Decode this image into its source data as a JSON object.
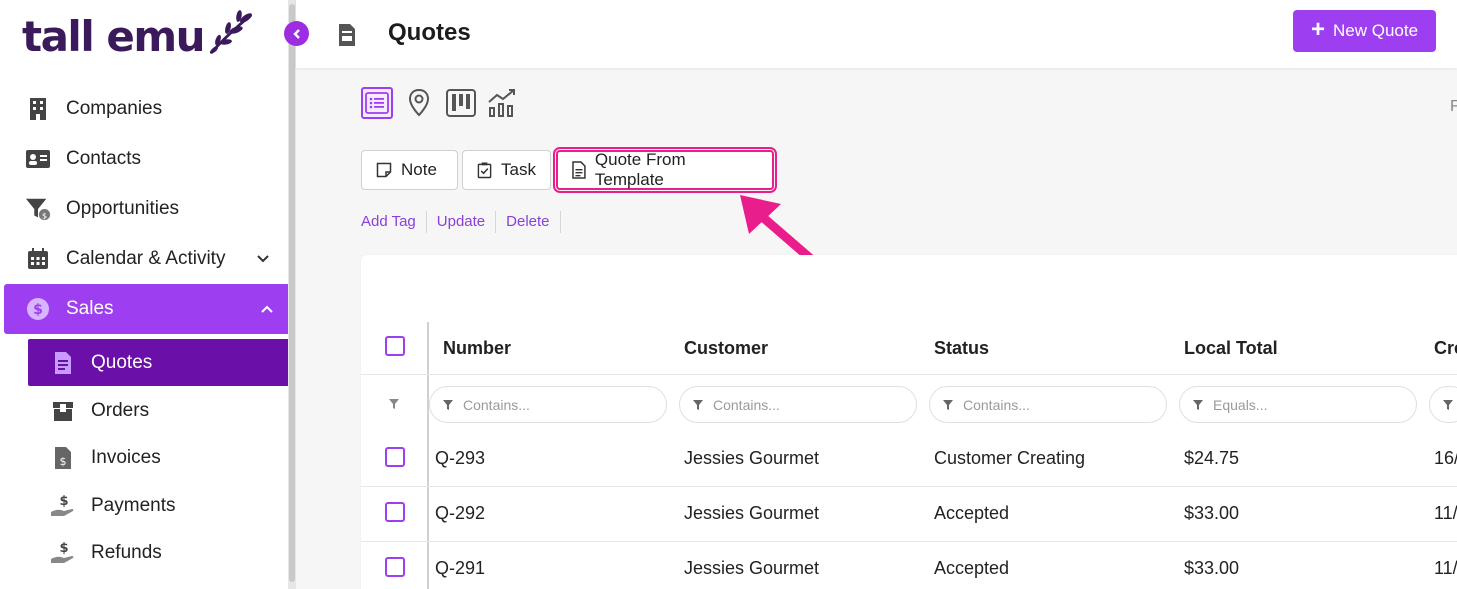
{
  "app": {
    "logo_text": "tall emu"
  },
  "sidebar": {
    "items": [
      {
        "label": "Companies",
        "icon": "building-icon"
      },
      {
        "label": "Contacts",
        "icon": "id-card-icon"
      },
      {
        "label": "Opportunities",
        "icon": "funnel-dollar-icon"
      },
      {
        "label": "Calendar & Activity",
        "icon": "calendar-icon"
      },
      {
        "label": "Sales",
        "icon": "dollar-circle-icon"
      }
    ],
    "sales_sub": [
      {
        "label": "Quotes",
        "icon": "quote-doc-icon"
      },
      {
        "label": "Orders",
        "icon": "box-icon"
      },
      {
        "label": "Invoices",
        "icon": "invoice-icon"
      },
      {
        "label": "Payments",
        "icon": "hand-dollar-icon"
      },
      {
        "label": "Refunds",
        "icon": "hand-dollar-icon"
      }
    ]
  },
  "header": {
    "title": "Quotes",
    "new_button": "New Quote"
  },
  "toolbar": {
    "views": [
      "list-view-icon",
      "map-pin-icon",
      "kanban-icon",
      "chart-icon"
    ],
    "edge_text": "F",
    "actions": {
      "note": "Note",
      "task": "Task",
      "quote_template": "Quote From Template"
    },
    "links": {
      "add_tag": "Add Tag",
      "update": "Update",
      "delete": "Delete"
    }
  },
  "grid": {
    "columns": [
      "Number",
      "Customer",
      "Status",
      "Local Total",
      "Cre"
    ],
    "filters": [
      "Contains...",
      "Contains...",
      "Contains...",
      "Equals..."
    ],
    "rows": [
      {
        "number": "Q-293",
        "customer": "Jessies Gourmet",
        "status": "Customer Creating",
        "total": "$24.75",
        "created": "16/"
      },
      {
        "number": "Q-292",
        "customer": "Jessies Gourmet",
        "status": "Accepted",
        "total": "$33.00",
        "created": "11/"
      },
      {
        "number": "Q-291",
        "customer": "Jessies Gourmet",
        "status": "Accepted",
        "total": "$33.00",
        "created": "11/"
      }
    ]
  },
  "colors": {
    "accent": "#9d3ff0",
    "active_sub": "#6a10a8",
    "highlight": "#e91e8c",
    "logo": "#3a1a5a"
  }
}
